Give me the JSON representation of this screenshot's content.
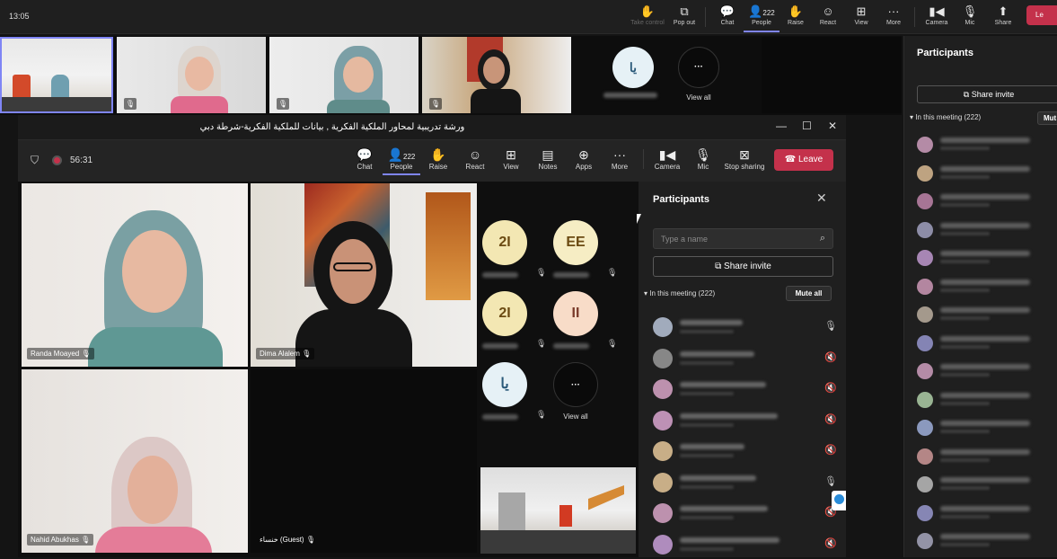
{
  "outer_toolbar": {
    "time": "13:05",
    "buttons": [
      {
        "label": "Take control",
        "icon": "take-control-icon"
      },
      {
        "label": "Pop out",
        "icon": "pop-out-icon"
      },
      {
        "label": "Chat",
        "icon": "chat-icon"
      },
      {
        "label": "People",
        "icon": "people-icon",
        "count": "222"
      },
      {
        "label": "Raise",
        "icon": "raise-hand-icon"
      },
      {
        "label": "React",
        "icon": "react-icon"
      },
      {
        "label": "View",
        "icon": "view-icon"
      },
      {
        "label": "More",
        "icon": "more-icon"
      },
      {
        "label": "Camera",
        "icon": "camera-icon"
      },
      {
        "label": "Mic",
        "icon": "mic-icon"
      },
      {
        "label": "Share",
        "icon": "share-icon"
      }
    ],
    "leave_label": "Le"
  },
  "top_strip": {
    "avatar_initials": "يا",
    "view_all_label": "View all"
  },
  "outer_participants": {
    "title": "Participants",
    "share_invite": "Share invite",
    "in_meeting": "In this meeting (222)",
    "mute_all": "Mut",
    "avatar_colors": [
      "#d9a6c8",
      "#e6c49a",
      "#c98bb3",
      "#a9a9c9",
      "#c9a0d9",
      "#d8a0c0",
      "#c6b8a8",
      "#9e9ed9",
      "#d9a6c8",
      "#b8d9b0",
      "#a6b8e6",
      "#d9a0a0",
      "#c7c7c7",
      "#a0a0d9",
      "#b0b0c8"
    ]
  },
  "window": {
    "title": "ورشة تدريبية لمحاور الملكية الفكرية , بيانات للملكية الفكرية-شرطة دبي"
  },
  "meeting_toolbar": {
    "timer": "56:31",
    "people_count": "222",
    "buttons": [
      {
        "label": "Chat",
        "icon": "chat-icon"
      },
      {
        "label": "People",
        "icon": "people-icon"
      },
      {
        "label": "Raise",
        "icon": "raise-hand-icon"
      },
      {
        "label": "React",
        "icon": "react-icon"
      },
      {
        "label": "View",
        "icon": "view-icon"
      },
      {
        "label": "Notes",
        "icon": "notes-icon"
      },
      {
        "label": "Apps",
        "icon": "apps-icon"
      },
      {
        "label": "More",
        "icon": "more-icon"
      },
      {
        "label": "Camera",
        "icon": "camera-icon"
      },
      {
        "label": "Mic",
        "icon": "mic-icon"
      },
      {
        "label": "Stop sharing",
        "icon": "stop-sharing-icon"
      }
    ],
    "leave_label": "Leave"
  },
  "video_tiles": [
    {
      "name": "Randa Moayed"
    },
    {
      "name": "Dima Alalem"
    },
    {
      "name": "Nahid Abukhas"
    },
    {
      "name": "خنساء (Guest)"
    }
  ],
  "avatar_grid": [
    {
      "initials": "2I"
    },
    {
      "initials": "EE"
    },
    {
      "initials": "2I"
    },
    {
      "initials": "II"
    },
    {
      "initials": "يا"
    },
    {
      "initials": "···",
      "label": "View all"
    }
  ],
  "participants": {
    "title": "Participants",
    "search_placeholder": "Type a name",
    "share_invite": "Share invite",
    "in_meeting": "In this meeting (222)",
    "mute_all": "Mute all",
    "rows": [
      {
        "color": "#b8c4d8",
        "mic": "mic-icon"
      },
      {
        "color": "#9a9a9a",
        "mic": "mic-off-icon"
      },
      {
        "color": "#d9a6c8",
        "mic": "mic-off-icon"
      },
      {
        "color": "#d9a6d0",
        "mic": "mic-off-icon"
      },
      {
        "color": "#e6c89a",
        "mic": "mic-off-icon"
      },
      {
        "color": "#e6c89a",
        "mic": "mic-icon"
      },
      {
        "color": "#d9a6c8",
        "mic": "mic-off-icon"
      },
      {
        "color": "#c9a0d9",
        "mic": "mic-off-icon"
      }
    ]
  }
}
